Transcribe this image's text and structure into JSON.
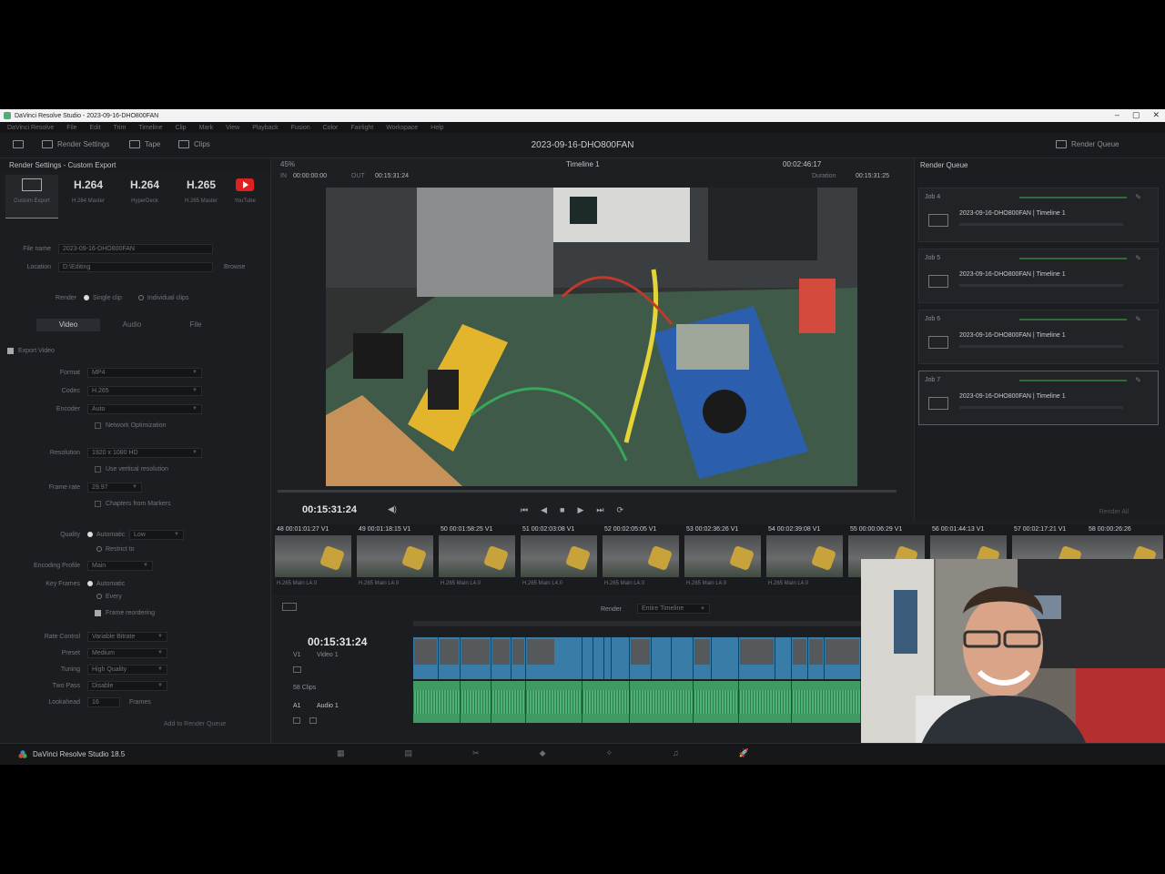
{
  "window": {
    "title": "DaVinci Resolve Studio - 2023-09-16-DHO800FAN",
    "controls": [
      "–",
      "▢",
      "✕"
    ]
  },
  "menu": [
    "DaVinci Resolve",
    "File",
    "Edit",
    "Trim",
    "Timeline",
    "Clip",
    "Mark",
    "View",
    "Playback",
    "Fusion",
    "Color",
    "Fairlight",
    "Workspace",
    "Help"
  ],
  "toolbar": {
    "render_settings": "Render Settings",
    "tape": "Tape",
    "clips": "Clips",
    "project_title": "2023-09-16-DHO800FAN",
    "render_queue": "Render Queue"
  },
  "render_settings": {
    "header": "Render Settings - Custom Export",
    "presets": [
      {
        "label": "",
        "sub": "Custom Export"
      },
      {
        "label": "H.264",
        "sub": "H.264 Master"
      },
      {
        "label": "H.264",
        "sub": "HyperDeck"
      },
      {
        "label": "H.265",
        "sub": "H.265 Master"
      },
      {
        "label": "",
        "sub": "YouTube"
      }
    ],
    "filename_label": "File name",
    "filename_value": "2023-09-16-DHO800FAN",
    "location_label": "Location",
    "location_value": "D:\\Editing",
    "browse": "Browse",
    "render_label": "Render",
    "single_clip": "Single clip",
    "individual_clips": "Individual clips",
    "tabs": [
      "Video",
      "Audio",
      "File"
    ],
    "export_video": "Export Video",
    "rows": [
      {
        "label": "Format",
        "value": "MP4"
      },
      {
        "label": "Codec",
        "value": "H.265"
      },
      {
        "label": "Encoder",
        "value": "Auto"
      }
    ],
    "network_optimization": "Network Optimization",
    "resolution_label": "Resolution",
    "resolution_value": "1920 x 1080 HD",
    "use_vertical": "Use vertical resolution",
    "framerate_label": "Frame rate",
    "framerate_value": "29.97",
    "chapters": "Chapters from Markers",
    "quality_label": "Quality",
    "quality_auto": "Automatic",
    "quality_value": "Low",
    "restrict_to": "Restrict to",
    "encoding_profile_label": "Encoding Profile",
    "encoding_profile_value": "Main",
    "keyframes_label": "Key Frames",
    "keyframes_auto": "Automatic",
    "keyframes_every": "Every",
    "frame_reordering": "Frame reordering",
    "rate_control_label": "Rate Control",
    "rate_control_value": "Variable Bitrate",
    "preset_label": "Preset",
    "preset_value": "Medium",
    "tuning_label": "Tuning",
    "tuning_value": "High Quality",
    "two_pass_label": "Two Pass",
    "two_pass_value": "Disable",
    "lookahead_label": "Lookahead",
    "lookahead_value": "16",
    "lookahead_unit": "Frames",
    "add_to_queue": "Add to Render Queue"
  },
  "viewer": {
    "zoom": "45%",
    "timeline_name": "Timeline 1",
    "duration_tc": "00:02:46:17",
    "in_label": "IN",
    "in_tc": "00:00:00:00",
    "out_label": "OUT",
    "out_tc": "00:15:31:24",
    "duration_label": "Duration",
    "total_tc": "00:15:31:25",
    "current_tc": "00:15:31:24",
    "transport": [
      "⏮",
      "◀",
      "■",
      "▶",
      "⏭",
      "⟳"
    ]
  },
  "render_queue": {
    "header": "Render Queue",
    "jobs": [
      {
        "id": "Job 4",
        "name": "2023-09-16-DHO800FAN | Timeline 1"
      },
      {
        "id": "Job 5",
        "name": "2023-09-16-DHO800FAN | Timeline 1"
      },
      {
        "id": "Job 6",
        "name": "2023-09-16-DHO800FAN | Timeline 1"
      },
      {
        "id": "Job 7",
        "name": "2023-09-16-DHO800FAN | Timeline 1"
      }
    ],
    "render_all": "Render All"
  },
  "clips": [
    {
      "num": "48",
      "tc": "00:01:01:27",
      "track": "V1",
      "codec": "H.265 Main L4.0"
    },
    {
      "num": "49",
      "tc": "00:01:18:15",
      "track": "V1",
      "codec": "H.265 Main L4.0"
    },
    {
      "num": "50",
      "tc": "00:01:58:25",
      "track": "V1",
      "codec": "H.265 Main L4.0"
    },
    {
      "num": "51",
      "tc": "00:02:03:08",
      "track": "V1",
      "codec": "H.265 Main L4.0"
    },
    {
      "num": "52",
      "tc": "00:02:05:05",
      "track": "V1",
      "codec": "H.265 Main L4.0"
    },
    {
      "num": "53",
      "tc": "00:02:36:26",
      "track": "V1",
      "codec": "H.265 Main L4.0"
    },
    {
      "num": "54",
      "tc": "00:02:39:08",
      "track": "V1",
      "codec": "H.265 Main L4.0"
    },
    {
      "num": "55",
      "tc": "00:00:06:29",
      "track": "V1",
      "codec": ""
    },
    {
      "num": "56",
      "tc": "00:01:44:13",
      "track": "V1",
      "codec": ""
    },
    {
      "num": "57",
      "tc": "00:02:17:21",
      "track": "V1",
      "codec": ""
    },
    {
      "num": "58",
      "tc": "00:00:26:26",
      "track": "V1",
      "codec": ""
    }
  ],
  "timeline": {
    "render_label": "Render",
    "render_value": "Entire Timeline",
    "current_tc": "00:15:31:24",
    "video_track": "Video 1",
    "video_track_id": "V1",
    "video_clips_count": "58 Clips",
    "audio_track_id": "A1",
    "audio_track": "Audio 1"
  },
  "bottom": {
    "brand": "DaVinci Resolve Studio 18.5",
    "pages": [
      "▦",
      "▤",
      "✂",
      "◆",
      "✧",
      "♫",
      "🚀"
    ]
  },
  "colors": {
    "video_clip": "#3a7ca8",
    "audio_clip": "#3f9b63",
    "youtube": "#e02020"
  }
}
